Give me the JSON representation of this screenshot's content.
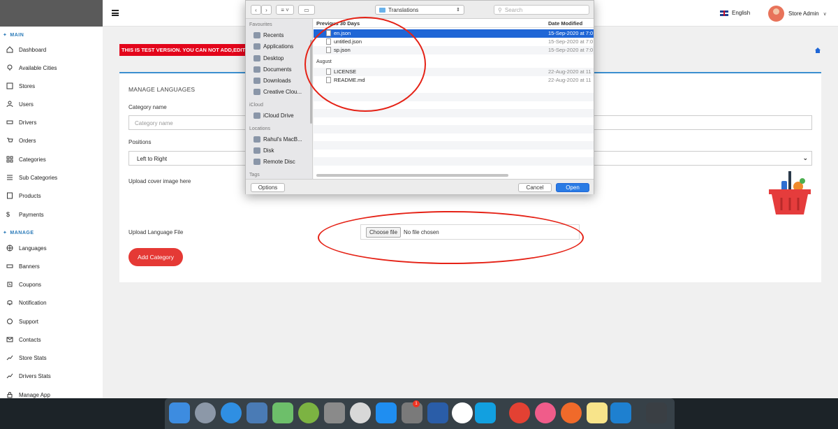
{
  "sidebar": {
    "section_main": "MAIN",
    "section_manage": "MANAGE",
    "items": [
      {
        "label": "Dashboard",
        "icon": "home-icon"
      },
      {
        "label": "Available Cities",
        "icon": "location-icon"
      },
      {
        "label": "Stores",
        "icon": "store-icon"
      },
      {
        "label": "Users",
        "icon": "user-icon"
      },
      {
        "label": "Drivers",
        "icon": "car-icon"
      },
      {
        "label": "Orders",
        "icon": "cart-icon"
      },
      {
        "label": "Categories",
        "icon": "grid-icon"
      },
      {
        "label": "Sub Categories",
        "icon": "sub-grid-icon"
      },
      {
        "label": "Products",
        "icon": "box-icon"
      },
      {
        "label": "Payments",
        "icon": "dollar-icon"
      },
      {
        "label": "Languages",
        "icon": "globe-icon"
      },
      {
        "label": "Banners",
        "icon": "banner-icon"
      },
      {
        "label": "Coupons",
        "icon": "coupon-icon"
      },
      {
        "label": "Notification",
        "icon": "bell-icon"
      },
      {
        "label": "Support",
        "icon": "chat-icon"
      },
      {
        "label": "Contacts",
        "icon": "mail-icon"
      },
      {
        "label": "Store Stats",
        "icon": "chart-icon"
      },
      {
        "label": "Drivers Stats",
        "icon": "chart-icon"
      },
      {
        "label": "Manage App",
        "icon": "lock-icon"
      }
    ]
  },
  "topbar": {
    "language": "English",
    "user_name": "Store Admin"
  },
  "banner": {
    "text": "THIS IS TEST VERSION. YOU CAN NOT ADD,EDIT"
  },
  "form": {
    "title": "MANAGE LANGUAGES",
    "category_name_label": "Category name",
    "category_name_placeholder": "Category name",
    "positions_label": "Positions",
    "positions_value": "Left to Right",
    "cover_label": "Upload cover image here",
    "file_label": "Upload Language File",
    "choose_file": "Choose file",
    "no_file": "No file chosen",
    "submit": "Add Category"
  },
  "dialog": {
    "folder": "Translations",
    "search_placeholder": "Search",
    "sidebar": {
      "favourites_header": "Favourites",
      "favourites": [
        "Recents",
        "Applications",
        "Desktop",
        "Documents",
        "Downloads",
        "Creative Clou..."
      ],
      "icloud_header": "iCloud",
      "icloud": [
        "iCloud Drive"
      ],
      "locations_header": "Locations",
      "locations": [
        "Rahul's MacB...",
        "Disk",
        "Remote Disc"
      ],
      "tags_header": "Tags"
    },
    "column_header": "Previous 30 Days",
    "date_header": "Date Modified",
    "recent_files": [
      {
        "name": "en.json",
        "date": "15-Sep-2020 at 7:0",
        "selected": true
      },
      {
        "name": "untitled.json",
        "date": "15-Sep-2020 at 7:0",
        "selected": false
      },
      {
        "name": "sp.json",
        "date": "15-Sep-2020 at 7:0",
        "selected": false
      }
    ],
    "group_august": "August",
    "august_files": [
      {
        "name": "LICENSE",
        "date": "22-Aug-2020 at 11"
      },
      {
        "name": "README.md",
        "date": "22-Aug-2020 at 11"
      }
    ],
    "options_button": "Options",
    "cancel_button": "Cancel",
    "open_button": "Open"
  },
  "dock": {
    "apps": [
      "finder-icon",
      "launchpad-icon",
      "safari-icon",
      "preview-icon",
      "maps-icon",
      "android-studio-icon",
      "calculator-icon",
      "tableplus-icon",
      "app-store-icon",
      "system-preferences-icon",
      "xcode-icon",
      "slack-icon",
      "skype-icon",
      "chrome-icon",
      "itunes-icon",
      "postman-icon",
      "notes-icon",
      "vscode-icon",
      "trash-icon"
    ],
    "badge": "1"
  },
  "colors": {
    "accent": "#2a7ab8",
    "danger": "#e53935",
    "selection": "#1f66d6"
  }
}
